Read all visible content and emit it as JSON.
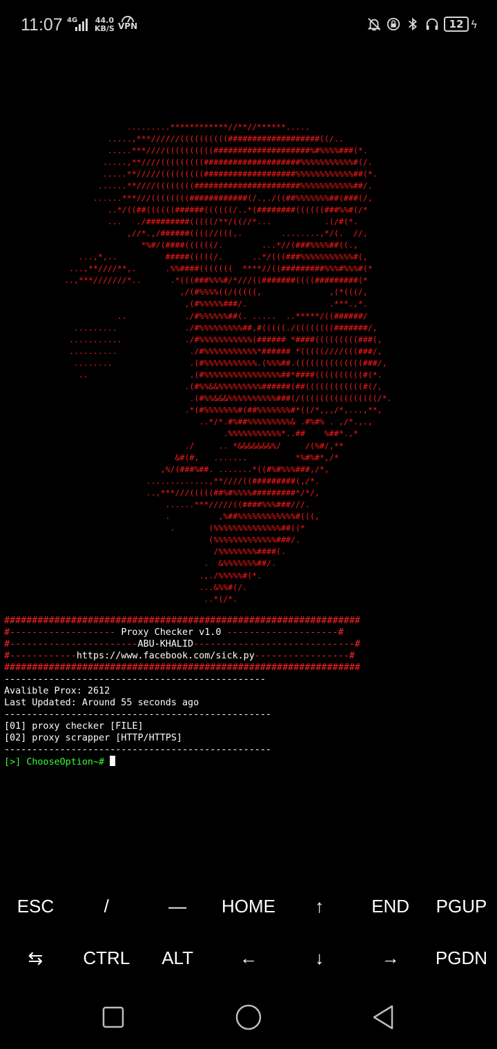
{
  "status_bar": {
    "time": "11:07",
    "network": "4G",
    "speed_value": "44.0",
    "speed_unit": "KB/S",
    "vpn": "VPN",
    "battery": "12"
  },
  "art": {
    "lines": [
      "              .........************//**//******.....",
      "          .....,***//////((((((((((###################((/..",
      "          .....***////((((((((((####################%#%%%%###(*.",
      "         .....,**////(((((((((####################%%%%%%%%%%%#(/.",
      "         .....**/////(((((((((###################%%%%%%%%%%%%##(*.",
      "        ......**////((((((((######################%%%%%%%%%%%##/.",
      "       ......***///((((((((############(/.,./((##%%%%%%%##(###(/,",
      "          ..*/((##((((((######((((((/..*(########((((((###%%#(/*",
      "          ...   ./#########(((((/**/((//*...           .(/#(*.",
      "              ,//*.,/######((((//(((,.        ........,*/(.  //,",
      "                 *%#/(####((((((/.        ...*//(###%%%%##((.,",
      "    ...,*,..          #####(((((/.      ..*/(((###%%%%%%%%%%%#(,",
      "  ...,**////**,.      .%%####(((((((  ****//((#########%%%#%%%#(*",
      " ..,***///////*..      .*(((###%%%#/*///((#######((((#########(*",
      "                         ,/(#%%%%((/(((((,              ,(*(((/,",
      "                          ,(#%%%%%###/.                 .***.,*.",
      "            ..            ./#%%%%%%##(. .....  ..*****/((######/",
      "   .........              ./#%%%%%%%%%##,#(((((./((((((((#######/,",
      "  ...........             ./#%%%%%%%%%%%(###### *####(((((((((###(,",
      "  ..........               ./#%%%%%%%%%%%*###### *(((((////(((###/,",
      "   ........                .(#%%%%%%%%%%%.(%%%##.((((((((((((((###/,",
      "    ..                     .(#%%%%%%%%%%%%%%%%##*####((((((((((#(*.",
      "                          .(#%%&&%%%%%%%%%######(##((((((((((((#(/,",
      "                           .(#%%&&&%%%%%%%%%%###(/((((((((((((((((/*.",
      "                          .*(#%%%%%%%#(##%%%%%%%#*((/*,,,/*,...,**,",
      "                             ..*/*.#%##%%%%%%%%%& .#%#% . ,/*.,.,",
      "                                  .%%%%%%%%%%%*..##    %##*.,*",
      "                          ./     .. *&&&&&&&%/     /(%#/,**",
      "                        &#(#,   .......          *%#%#*,/*",
      "                     ,%/(###%##. .......*((#%#%%%###,/*,",
      "                  .............,**////((#########(,/*.",
      "                  ..,***///(((((##%#%%%%#########*/*/,",
      "                      ......***/////((####%%%###///.",
      "                      .          ,%##%%%%%%%%%%%%#(((,",
      "                       .       (%%%%%%%%%%%%%%##((*",
      "                               (%%%%%%%%%%%%%###/.",
      "                                /%%%%%%%%####(.",
      "                              .  &%%%%%%%##/.",
      "                             .,./%%%%%#(*.",
      "                             ...&%%#(/.",
      "                              ..*(/*."
    ]
  },
  "terminal": {
    "lines": [
      {
        "text": "################################################################",
        "color": "red"
      },
      {
        "parts": [
          {
            "text": "#------------------- ",
            "color": "red"
          },
          {
            "text": "Proxy Checker v1.0",
            "color": "white"
          },
          {
            "text": " --------------------#",
            "color": "red"
          }
        ]
      },
      {
        "parts": [
          {
            "text": "#-----------------------",
            "color": "red"
          },
          {
            "text": "ABU-KHALID",
            "color": "white"
          },
          {
            "text": "-----------------------------#",
            "color": "red"
          }
        ]
      },
      {
        "parts": [
          {
            "text": "#------------",
            "color": "red"
          },
          {
            "text": "https://www.facebook.com/sick.py",
            "color": "white"
          },
          {
            "text": "-----------------#",
            "color": "red"
          }
        ]
      },
      {
        "text": "################################################################",
        "color": "red"
      },
      {
        "text": "-----------------------------------------------",
        "color": "white"
      },
      {
        "text": "Avalible Prox: 2612",
        "color": "white"
      },
      {
        "text": "Last Updated: Around 55 seconds ago",
        "color": "white"
      },
      {
        "text": "------------------------------------------------",
        "color": "white"
      },
      {
        "text": "[01] proxy checker [FILE]",
        "color": "white"
      },
      {
        "text": "[02] proxy scrapper [HTTP/HTTPS]",
        "color": "white"
      },
      {
        "text": "------------------------------------------------",
        "color": "white"
      }
    ],
    "prompt": "[>] ChooseOption~#"
  },
  "extra_keys": {
    "row1": [
      "ESC",
      "/",
      "—",
      "HOME",
      "↑",
      "END",
      "PGUP"
    ],
    "row2": [
      "⇆",
      "CTRL",
      "ALT",
      "←",
      "↓",
      "→",
      "PGDN"
    ]
  }
}
